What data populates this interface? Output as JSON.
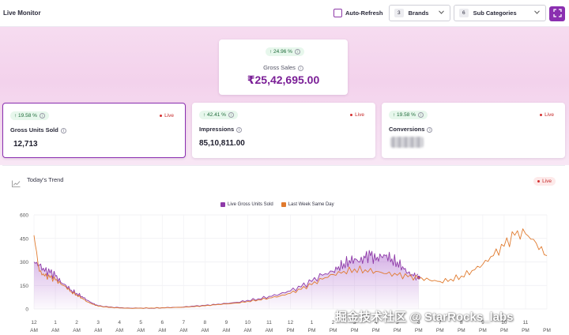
{
  "header": {
    "title": "Live Monitor",
    "auto_refresh_label": "Auto-Refresh",
    "brands": {
      "count": "3",
      "label": "Brands"
    },
    "sub_categories": {
      "count": "6",
      "label": "Sub Categories"
    }
  },
  "gross_sales": {
    "change": "↑ 24.96 %",
    "label": "Gross Sales",
    "value": "₹25,42,695.00"
  },
  "kpis": [
    {
      "change": "↑ 19.58 %",
      "label": "Gross Units Sold",
      "value": "12,713",
      "live": "Live"
    },
    {
      "change": "↑ 42.41 %",
      "label": "Impressions",
      "value": "85,10,811.00",
      "live": "Live"
    },
    {
      "change": "↑ 19.58 %",
      "label": "Conversions",
      "value": "",
      "live": "Live"
    }
  ],
  "trend": {
    "title": "Today's Trend",
    "live": "Live"
  },
  "watermark": "掘金技术社区 @ StarRocks_labs",
  "colors": {
    "accent": "#8b2fb0",
    "live_series": "#8e3aa8",
    "last_week_series": "#e07a2e",
    "live_red": "#d43030"
  },
  "chart_data": {
    "type": "line",
    "legend": "top-center",
    "ylim": [
      0,
      600
    ],
    "y_ticks": [
      0,
      150,
      300,
      450,
      600
    ],
    "x_ticks": [
      {
        "top": "12",
        "bottom": "AM"
      },
      {
        "top": "1",
        "bottom": "AM"
      },
      {
        "top": "2",
        "bottom": "AM"
      },
      {
        "top": "3",
        "bottom": "AM"
      },
      {
        "top": "4",
        "bottom": "AM"
      },
      {
        "top": "5",
        "bottom": "AM"
      },
      {
        "top": "6",
        "bottom": "AM"
      },
      {
        "top": "7",
        "bottom": "AM"
      },
      {
        "top": "8",
        "bottom": "AM"
      },
      {
        "top": "9",
        "bottom": "AM"
      },
      {
        "top": "10",
        "bottom": "AM"
      },
      {
        "top": "11",
        "bottom": "AM"
      },
      {
        "top": "12",
        "bottom": "PM"
      },
      {
        "top": "1",
        "bottom": "PM"
      },
      {
        "top": "2",
        "bottom": "PM"
      },
      {
        "top": "3",
        "bottom": "PM"
      },
      {
        "top": "4",
        "bottom": "PM"
      },
      {
        "top": "5",
        "bottom": "PM"
      },
      {
        "top": "6",
        "bottom": "PM"
      },
      {
        "top": "7",
        "bottom": "PM"
      },
      {
        "top": "8",
        "bottom": "PM"
      },
      {
        "top": "9",
        "bottom": "PM"
      },
      {
        "top": "10",
        "bottom": "PM"
      },
      {
        "top": "11",
        "bottom": "PM"
      },
      {
        "top": "",
        "bottom": "PM"
      }
    ],
    "series": [
      {
        "name": "Live Gross Units Sold",
        "x": [
          0,
          0.25,
          0.5,
          0.75,
          1,
          1.25,
          1.5,
          1.75,
          2,
          2.25,
          2.5,
          2.75,
          3,
          3.5,
          4,
          4.5,
          5,
          5.5,
          6,
          6.5,
          7,
          7.5,
          8,
          8.5,
          9,
          9.5,
          10,
          10.5,
          11,
          11.5,
          12,
          12.5,
          13,
          13.5,
          14,
          14.25,
          14.5,
          14.75,
          15,
          15.25,
          15.5,
          15.75,
          16,
          16.25,
          16.5,
          16.75,
          17,
          17.25,
          17.5,
          17.75,
          18
        ],
        "y": [
          300,
          280,
          240,
          230,
          210,
          170,
          150,
          120,
          100,
          80,
          55,
          35,
          20,
          12,
          8,
          5,
          6,
          5,
          8,
          10,
          12,
          18,
          22,
          28,
          35,
          42,
          55,
          65,
          80,
          95,
          115,
          140,
          175,
          215,
          240,
          270,
          290,
          310,
          320,
          300,
          325,
          340,
          310,
          335,
          345,
          320,
          300,
          270,
          230,
          210,
          200
        ]
      },
      {
        "name": "Last Week Same Day",
        "x": [
          0,
          0.25,
          0.5,
          0.75,
          1,
          1.25,
          1.5,
          1.75,
          2,
          2.25,
          2.5,
          2.75,
          3,
          3.5,
          4,
          4.5,
          5,
          5.5,
          6,
          6.5,
          7,
          7.5,
          8,
          8.5,
          9,
          9.5,
          10,
          10.5,
          11,
          11.5,
          12,
          12.5,
          13,
          13.5,
          14,
          14.5,
          15,
          15.5,
          16,
          16.5,
          17,
          17.5,
          18,
          18.5,
          19,
          19.5,
          20,
          20.5,
          21,
          21.5,
          22,
          22.5,
          23,
          23.5,
          24
        ],
        "y": [
          470,
          240,
          210,
          200,
          185,
          160,
          140,
          110,
          90,
          70,
          45,
          30,
          18,
          10,
          6,
          4,
          5,
          6,
          7,
          9,
          11,
          15,
          20,
          26,
          32,
          38,
          48,
          58,
          70,
          82,
          100,
          125,
          155,
          190,
          220,
          240,
          255,
          250,
          240,
          225,
          215,
          205,
          195,
          185,
          175,
          190,
          210,
          245,
          285,
          340,
          400,
          470,
          480,
          420,
          340
        ]
      }
    ]
  }
}
